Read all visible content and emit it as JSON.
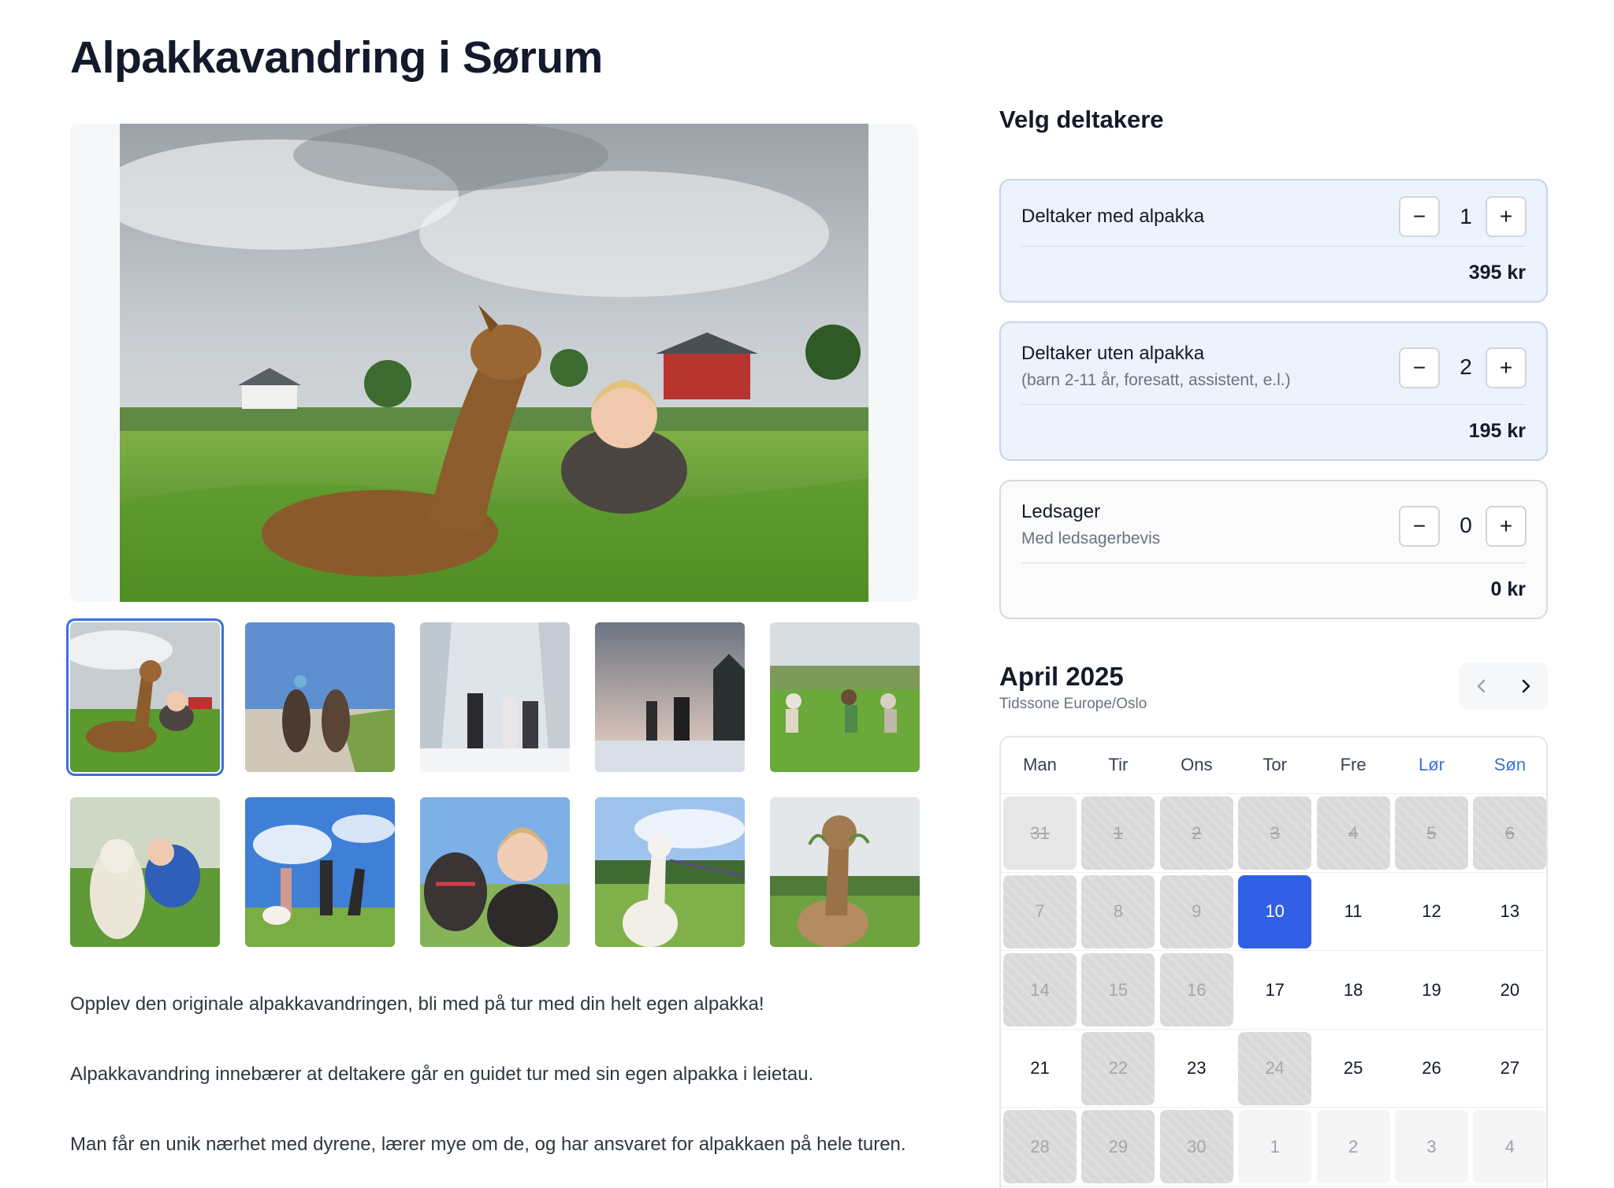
{
  "page": {
    "title": "Alpakkavandring i Sørum"
  },
  "gallery": {
    "main_alt": "Alpakka og kvinne i gresset",
    "thumbnails": [
      "alpakka og kvinne i gress",
      "to alpakkaer på grusvei",
      "vintertur i snøskog",
      "silhuett i skumring",
      "gruppe på jordet",
      "alpakka med kvinne",
      "to personer med alpakkaer",
      "selfie med alpakka",
      "hvit alpakka",
      "alpakka spiser gress"
    ]
  },
  "description": [
    "Opplev den originale alpakkavandringen, bli med på tur med din helt egen alpakka!",
    "Alpakkavandring innebærer at deltakere går en guidet tur med sin egen alpakka i leietau.",
    "Man får en unik nærhet med dyrene, lærer mye om de, og har ansvaret for alpakkaen på hele turen."
  ],
  "participants": {
    "title": "Velg deltakere",
    "items": [
      {
        "name": "Deltaker med alpakka",
        "sub": "",
        "count": "1",
        "price": "395 kr",
        "minus": "−",
        "plus": "+"
      },
      {
        "name": "Deltaker uten alpakka",
        "sub": "(barn 2-11 år, foresatt, assistent, e.l.)",
        "count": "2",
        "price": "195 kr",
        "minus": "−",
        "plus": "+"
      },
      {
        "name": "Ledsager",
        "sub": "Med ledsagerbevis",
        "count": "0",
        "price": "0 kr",
        "minus": "−",
        "plus": "+"
      }
    ]
  },
  "calendar": {
    "month": "April 2025",
    "timezone": "Tidssone Europe/Oslo",
    "weekdays": [
      "Man",
      "Tir",
      "Ons",
      "Tor",
      "Fre",
      "Lør",
      "Søn"
    ],
    "selected_day": "10",
    "accent_color": "#3160e6",
    "weeks": [
      [
        {
          "d": "31",
          "s": "other-unavail"
        },
        {
          "d": "1",
          "s": "unavail"
        },
        {
          "d": "2",
          "s": "unavail"
        },
        {
          "d": "3",
          "s": "unavail"
        },
        {
          "d": "4",
          "s": "unavail"
        },
        {
          "d": "5",
          "s": "unavail"
        },
        {
          "d": "6",
          "s": "unavail"
        }
      ],
      [
        {
          "d": "7",
          "s": "unavail"
        },
        {
          "d": "8",
          "s": "unavail"
        },
        {
          "d": "9",
          "s": "unavail"
        },
        {
          "d": "10",
          "s": "selected"
        },
        {
          "d": "11",
          "s": "avail"
        },
        {
          "d": "12",
          "s": "avail"
        },
        {
          "d": "13",
          "s": "avail"
        }
      ],
      [
        {
          "d": "14",
          "s": "unavail"
        },
        {
          "d": "15",
          "s": "unavail"
        },
        {
          "d": "16",
          "s": "unavail"
        },
        {
          "d": "17",
          "s": "avail"
        },
        {
          "d": "18",
          "s": "avail"
        },
        {
          "d": "19",
          "s": "avail"
        },
        {
          "d": "20",
          "s": "avail"
        }
      ],
      [
        {
          "d": "21",
          "s": "avail"
        },
        {
          "d": "22",
          "s": "unavail"
        },
        {
          "d": "23",
          "s": "avail"
        },
        {
          "d": "24",
          "s": "unavail"
        },
        {
          "d": "25",
          "s": "avail"
        },
        {
          "d": "26",
          "s": "avail"
        },
        {
          "d": "27",
          "s": "avail"
        }
      ],
      [
        {
          "d": "28",
          "s": "unavail"
        },
        {
          "d": "29",
          "s": "unavail"
        },
        {
          "d": "30",
          "s": "unavail"
        },
        {
          "d": "1",
          "s": "other"
        },
        {
          "d": "2",
          "s": "other"
        },
        {
          "d": "3",
          "s": "other"
        },
        {
          "d": "4",
          "s": "other"
        }
      ]
    ]
  }
}
